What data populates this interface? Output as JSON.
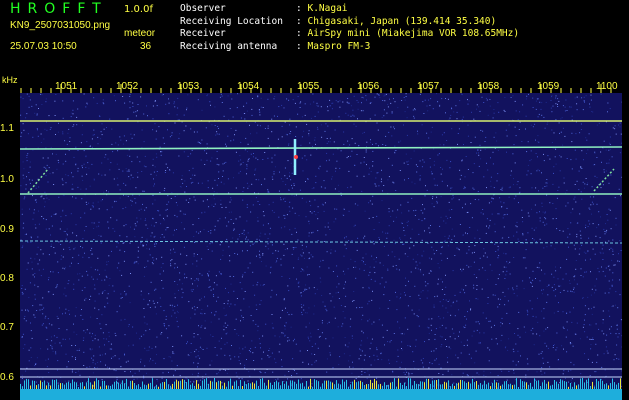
{
  "header": {
    "app_title": "HROFFT",
    "version": "1.0.0f",
    "filename": "KN9_2507031050.png",
    "meteor_label": "meteor",
    "timestamp": "25.07.03 10:50",
    "meteor_count": "36"
  },
  "info": [
    {
      "key": "Observer",
      "value": "K.Nagai"
    },
    {
      "key": "Receiving Location",
      "value": "Chigasaki, Japan (139.414 35.340)"
    },
    {
      "key": "Receiver",
      "value": "AirSpy mini (Miakejima VOR 108.65MHz)"
    },
    {
      "key": "Receiving antenna",
      "value": "Maspro FM-3"
    }
  ],
  "separator": ":",
  "axis": {
    "y_unit": "kHz",
    "y_ticks": [
      "1.1",
      "1.0",
      "0.9",
      "0.8",
      "0.7",
      "0.6"
    ],
    "x_ticks": [
      "1051",
      "1052",
      "1053",
      "1054",
      "1055",
      "1056",
      "1057",
      "1058",
      "1059",
      "1100"
    ]
  },
  "colors": {
    "background": "#000000",
    "spectrogram_bg": "#12125e",
    "label": "#ffff44",
    "title": "#22ff22",
    "signal": "#7fe7ff"
  }
}
